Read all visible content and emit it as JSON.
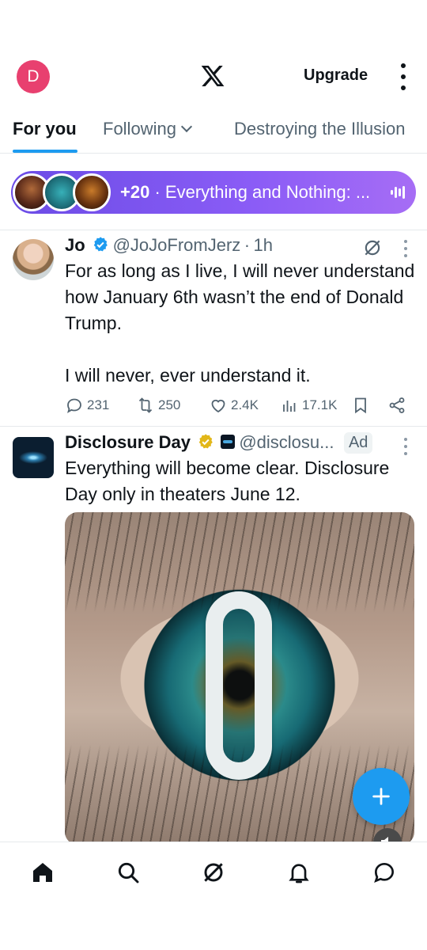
{
  "header": {
    "avatar_letter": "D",
    "upgrade_label": "Upgrade"
  },
  "tabs": [
    {
      "label": "For you",
      "active": true
    },
    {
      "label": "Following",
      "active": false
    },
    {
      "label": "Destroying the Illusion",
      "active": false
    }
  ],
  "spaces": {
    "count": "+20",
    "separator": "·",
    "title": "Everything and Nothing: ..."
  },
  "tweets": [
    {
      "name": "Jo",
      "handle": "@JoJoFromJerz",
      "dot": "·",
      "time": "1h",
      "text": "For as long as I live, I will never understand how January 6th wasn’t the end of Donald Trump.\n\nI will never, ever understand it.",
      "replies": "231",
      "reposts": "250",
      "likes": "2.4K",
      "views": "17.1K"
    },
    {
      "name": "Disclosure Day",
      "handle": "@disclosu...",
      "ad_label": "Ad",
      "text": "Everything will become clear. Disclosure Day only in theaters June 12."
    }
  ],
  "colors": {
    "accent": "#1d9bf0",
    "avatar_bg": "#e8406f",
    "spaces_gradient_start": "#6b4ce6",
    "spaces_gradient_end": "#a66df5",
    "gold_verified": "#e2b719"
  },
  "icons": {
    "nav": [
      "home-icon",
      "search-icon",
      "grok-icon",
      "bell-icon",
      "messages-icon"
    ]
  }
}
